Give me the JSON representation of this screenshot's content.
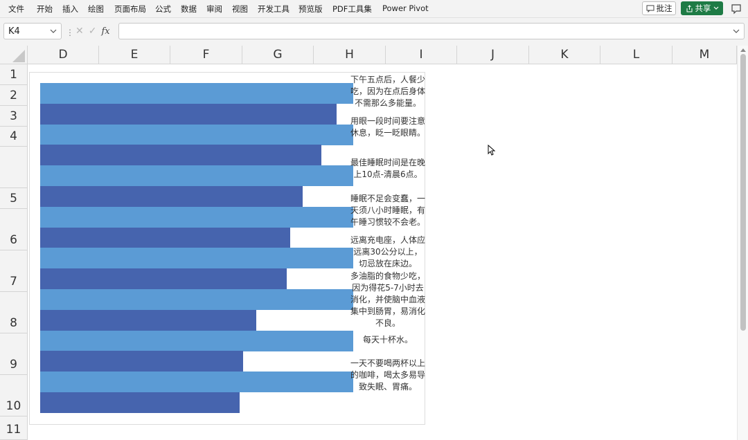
{
  "ribbon": {
    "menu_items": [
      "文件",
      "开始",
      "插入",
      "绘图",
      "页面布局",
      "公式",
      "数据",
      "审阅",
      "视图",
      "开发工具",
      "预览版",
      "PDF工具集",
      "Power Pivot"
    ],
    "comment_label": "批注",
    "share_label": "共享"
  },
  "formula_bar": {
    "name_box": "K4",
    "fx_label": "fx",
    "formula": ""
  },
  "columns": [
    "D",
    "E",
    "F",
    "G",
    "H",
    "I",
    "J",
    "K",
    "L",
    "M"
  ],
  "rows": [
    "1",
    "2",
    "3",
    "4",
    "",
    "5",
    "6",
    "7",
    "8",
    "9",
    "10",
    "11"
  ],
  "chart_data": {
    "type": "bar",
    "orientation": "horizontal",
    "colors": {
      "light": "#5b9bd5",
      "dark": "#4664ae"
    },
    "bars": [
      {
        "value": 1.0,
        "color": "light"
      },
      {
        "value": 0.948,
        "color": "dark"
      },
      {
        "value": 1.0,
        "color": "light"
      },
      {
        "value": 0.898,
        "color": "dark"
      },
      {
        "value": 1.0,
        "color": "light"
      },
      {
        "value": 0.838,
        "color": "dark"
      },
      {
        "value": 1.0,
        "color": "light"
      },
      {
        "value": 0.798,
        "color": "dark"
      },
      {
        "value": 1.0,
        "color": "light"
      },
      {
        "value": 0.788,
        "color": "dark"
      },
      {
        "value": 1.0,
        "color": "light"
      },
      {
        "value": 0.69,
        "color": "dark"
      },
      {
        "value": 1.0,
        "color": "light"
      },
      {
        "value": 0.648,
        "color": "dark"
      },
      {
        "value": 1.0,
        "color": "light"
      },
      {
        "value": 0.638,
        "color": "dark"
      }
    ],
    "annotations": [
      "下午五点后，人餐少吃，因为在点后身体不需那么多能量。",
      "用眼一段时间要注意休息，眨一眨眼睛。",
      "最佳睡眠时间是在晚上10点-清晨6点。",
      "睡眠不足会变蠢，一天须八小时睡眠，有午睡习惯较不会老。",
      "远离充电座，人体应远离30公分以上，切忌放在床边。",
      "多油脂的食物少吃，因为得花5-7小时去消化，并使脑中血液集中到肠胃，易消化不良。",
      "每天十杯水。",
      "一天不要喝两杯以上的咖啡，喝太多易导致失眠、胃痛。"
    ]
  }
}
